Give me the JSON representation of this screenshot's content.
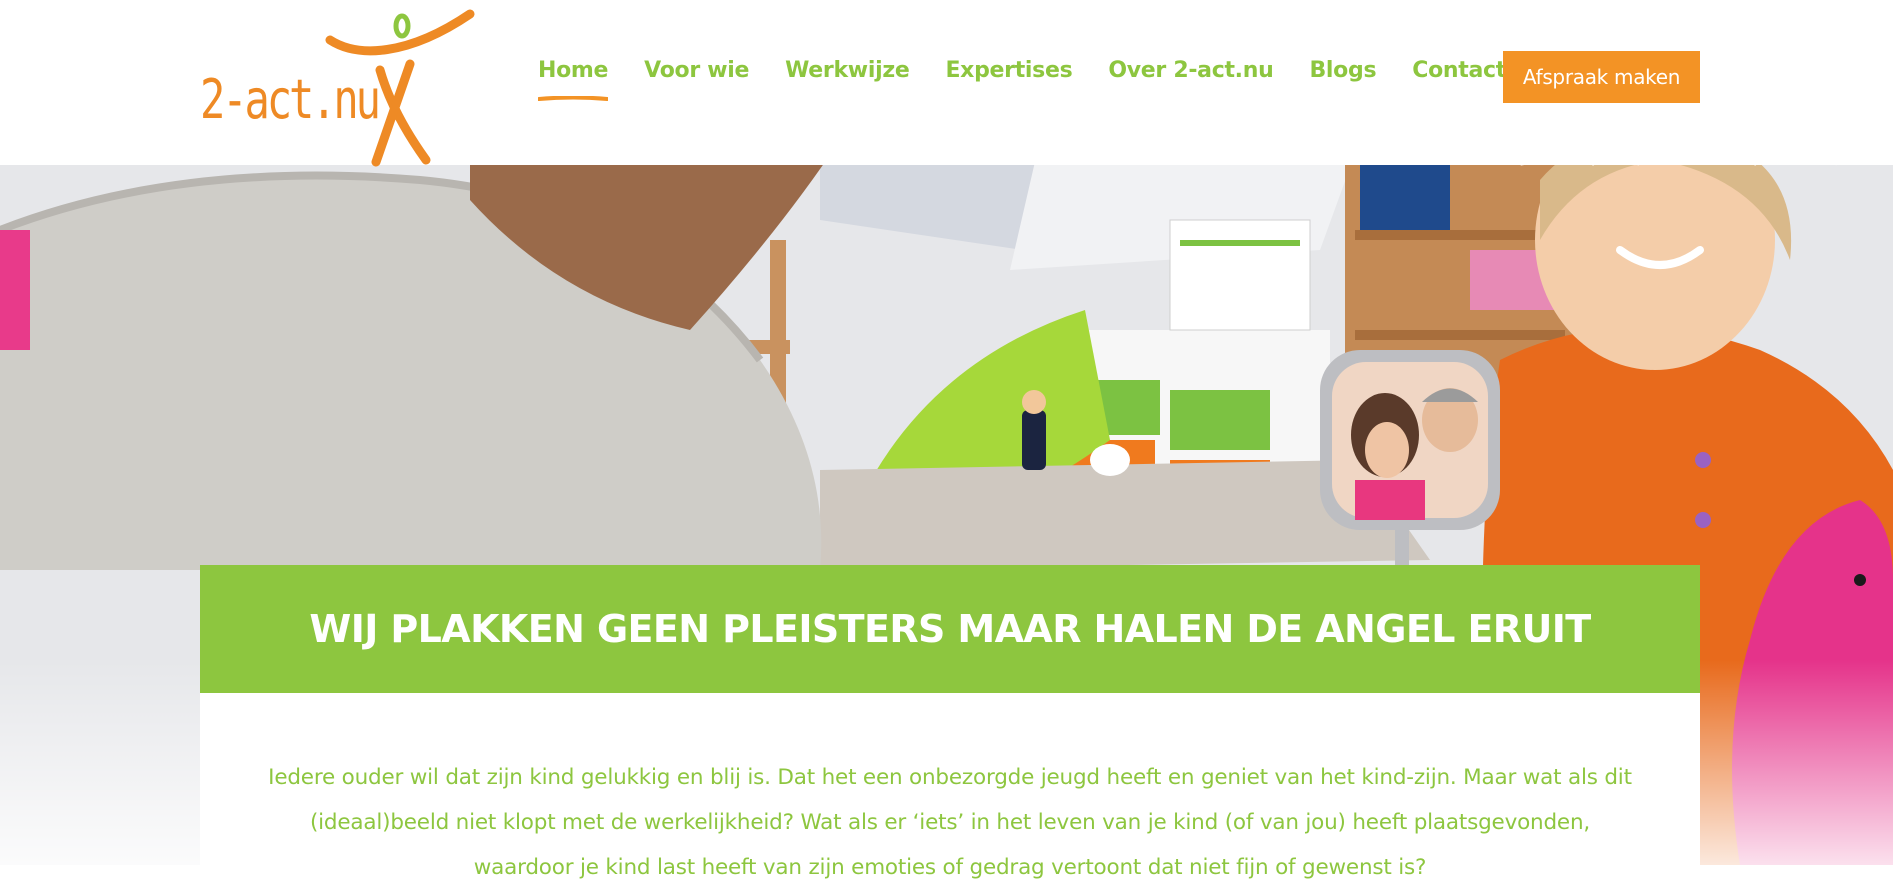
{
  "brand": {
    "logo_text": "2-act.nu",
    "colors": {
      "orange": "#f39325",
      "green": "#8dc63f",
      "white": "#ffffff"
    }
  },
  "nav": {
    "items": [
      {
        "label": "Home",
        "active": true
      },
      {
        "label": "Voor wie",
        "active": false
      },
      {
        "label": "Werkwijze",
        "active": false
      },
      {
        "label": "Expertises",
        "active": false
      },
      {
        "label": "Over 2-act.nu",
        "active": false
      },
      {
        "label": "Blogs",
        "active": false
      },
      {
        "label": "Contact",
        "active": false
      }
    ],
    "cta_label": "Afspraak maken"
  },
  "hero": {
    "image_subject": "photo of child looking in a hand mirror in a playroom"
  },
  "main": {
    "headline": "WIJ PLAKKEN GEEN PLEISTERS MAAR HALEN DE ANGEL ERUIT",
    "intro_lines": [
      "Iedere ouder wil dat zijn kind gelukkig en blij is. Dat het een onbezorgde jeugd heeft en geniet van het kind-zijn. Maar wat als dit",
      "(ideaal)beeld niet klopt met de werkelijkheid? Wat als er ‘iets’ in het leven van je kind (of van jou) heeft plaatsgevonden,",
      "waardoor je kind last heeft van zijn emoties of gedrag vertoont dat niet fijn of gewenst is?"
    ]
  }
}
